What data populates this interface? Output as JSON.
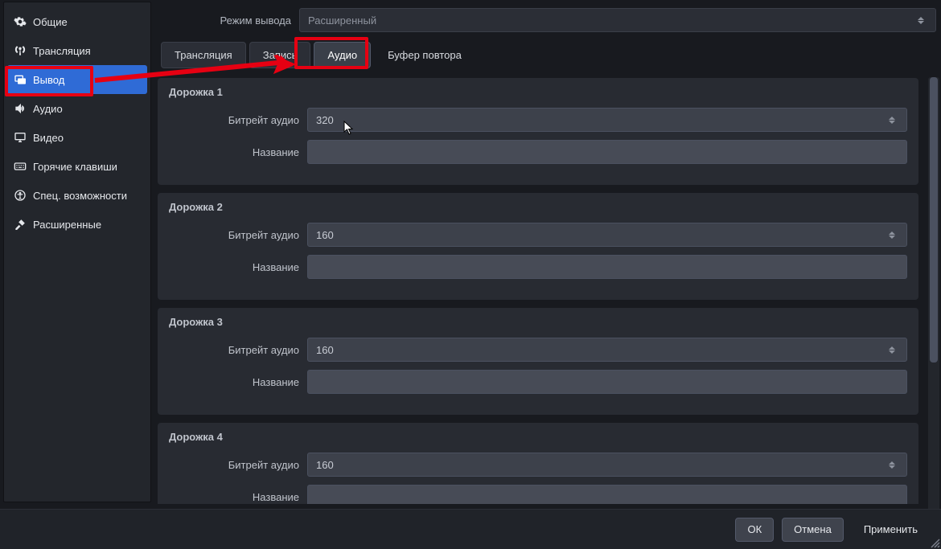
{
  "sidebar": {
    "items": [
      {
        "label": "Общие",
        "iconName": "gear-icon"
      },
      {
        "label": "Трансляция",
        "iconName": "antenna-icon"
      },
      {
        "label": "Вывод",
        "iconName": "output-icon",
        "active": true
      },
      {
        "label": "Аудио",
        "iconName": "speaker-icon"
      },
      {
        "label": "Видео",
        "iconName": "monitor-icon"
      },
      {
        "label": "Горячие клавиши",
        "iconName": "keyboard-icon"
      },
      {
        "label": "Спец. возможности",
        "iconName": "accessibility-icon"
      },
      {
        "label": "Расширенные",
        "iconName": "tools-icon"
      }
    ]
  },
  "output_mode": {
    "label": "Режим вывода",
    "value": "Расширенный"
  },
  "tabs": [
    {
      "label": "Трансляция"
    },
    {
      "label": "Запись"
    },
    {
      "label": "Аудио",
      "active": true
    },
    {
      "label": "Буфер повтора"
    }
  ],
  "tracks_common": {
    "bitrate_label": "Битрейт аудио",
    "name_label": "Название"
  },
  "tracks": [
    {
      "title": "Дорожка 1",
      "bitrate": "320",
      "name": ""
    },
    {
      "title": "Дорожка 2",
      "bitrate": "160",
      "name": ""
    },
    {
      "title": "Дорожка 3",
      "bitrate": "160",
      "name": ""
    },
    {
      "title": "Дорожка 4",
      "bitrate": "160",
      "name": ""
    }
  ],
  "footer": {
    "ok": "ОК",
    "cancel": "Отмена",
    "apply": "Применить"
  },
  "colors": {
    "highlight": "#e60012",
    "selection": "#2f6bd6",
    "panel": "#282b32",
    "bg": "#181a1f"
  }
}
